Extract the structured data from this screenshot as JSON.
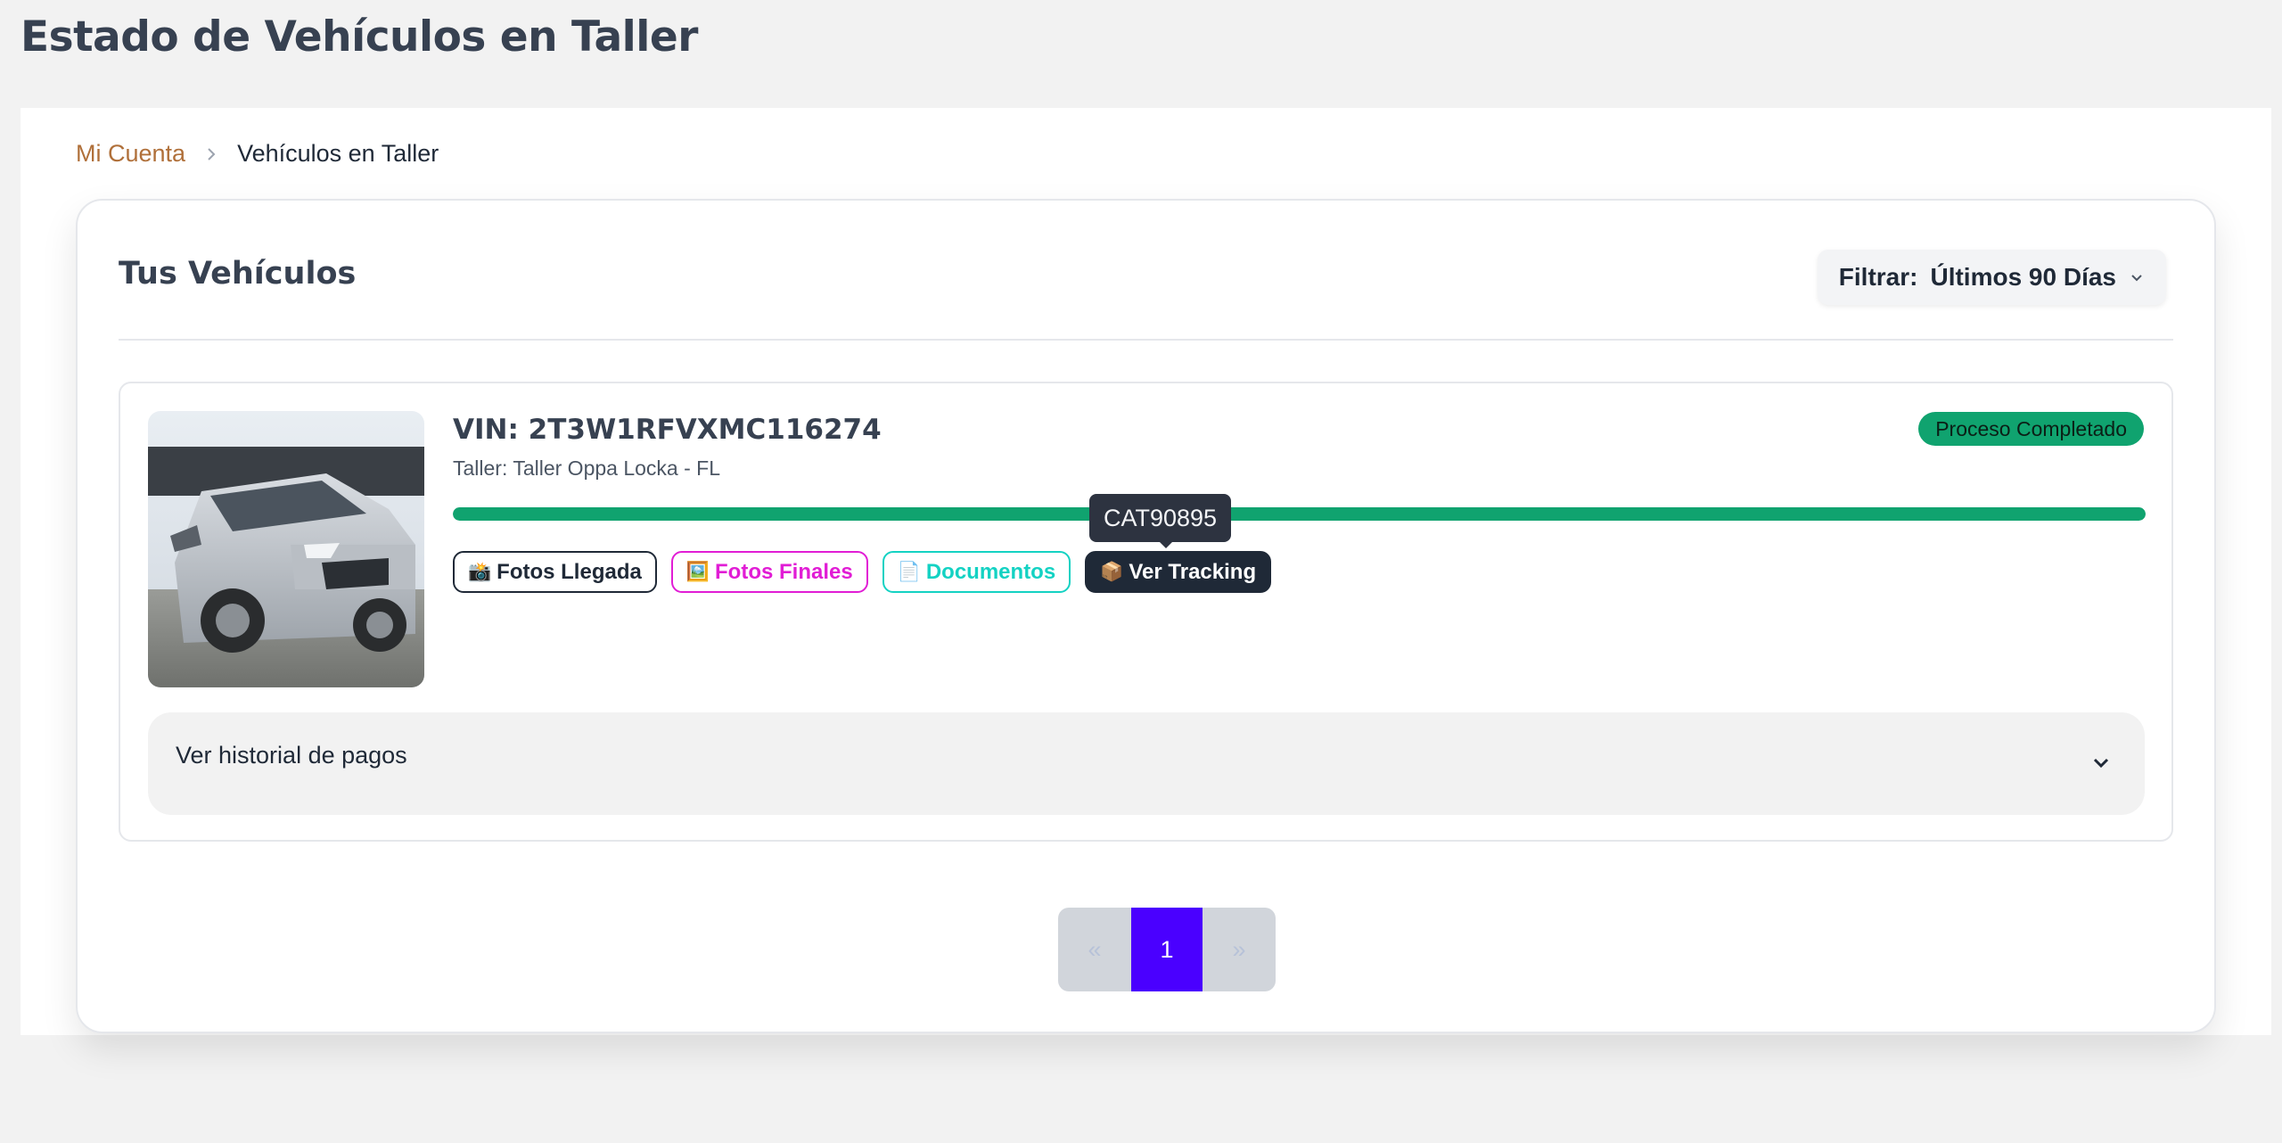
{
  "page": {
    "title": "Estado de Vehículos en Taller"
  },
  "breadcrumb": {
    "parent": "Mi Cuenta",
    "current": "Vehículos en Taller"
  },
  "card": {
    "title": "Tus Vehículos",
    "filter": {
      "label": "Filtrar:",
      "value": "Últimos 90 Días"
    }
  },
  "vehicle": {
    "vin": "VIN: 2T3W1RFVXMC116274",
    "workshop": "Taller: Taller Oppa Locka - FL",
    "status": "Proceso Completado",
    "progress": 1.0,
    "tooltip": "CAT90895",
    "actions": [
      {
        "emoji": "📸",
        "label": "Fotos Llegada"
      },
      {
        "emoji": "🖼️",
        "label": "Fotos Finales"
      },
      {
        "emoji": "📄",
        "label": "Documentos"
      },
      {
        "emoji": "📦",
        "label": "Ver Tracking"
      }
    ],
    "payments_label": "Ver historial de pagos"
  },
  "pagination": {
    "prev": "«",
    "current": "1",
    "next": "»"
  },
  "colors": {
    "accent": "#4a00ff",
    "success": "#10a36f",
    "link": "#b0703a",
    "magenta": "#e11dd5",
    "teal": "#14d2c3"
  },
  "icons": {
    "breadcrumb_separator": "chevron-right-icon",
    "filter_dropdown": "chevron-down-icon",
    "payments_toggle": "chevron-down-icon"
  }
}
